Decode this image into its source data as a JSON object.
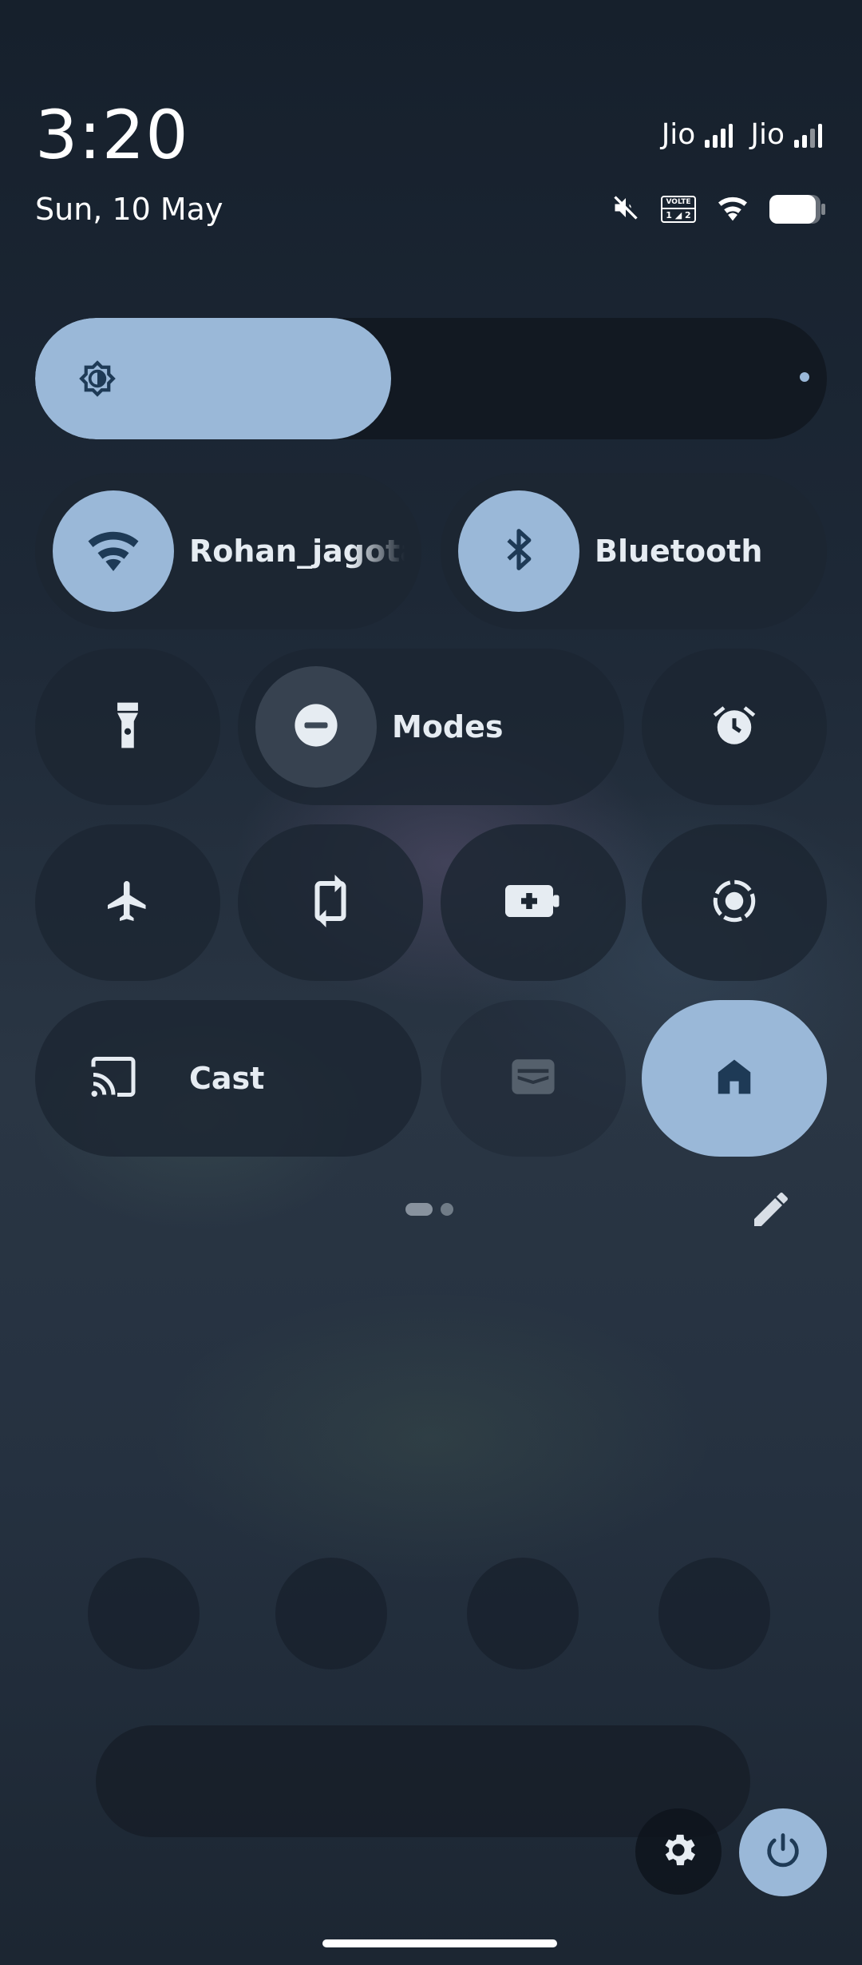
{
  "status_bar": {
    "time": "3:20",
    "date": "Sun, 10 May",
    "carriers": [
      "Jio",
      "Jio"
    ],
    "volte_label": "VOLTE",
    "volte_sim": "1 ◢ 2",
    "icons": [
      "mute-icon",
      "volte-icon",
      "wifi-icon",
      "battery-icon"
    ]
  },
  "brightness": {
    "level": 0.45,
    "icon": "brightness-icon"
  },
  "tiles": {
    "wifi": {
      "label": "Rohan_jagota",
      "state": "on",
      "icon": "wifi-icon"
    },
    "bluetooth": {
      "label": "Bluetooth",
      "state": "on",
      "icon": "bluetooth-icon"
    },
    "flashlight": {
      "icon": "flashlight-icon",
      "state": "off"
    },
    "modes": {
      "label": "Modes",
      "state": "off",
      "icon": "do-not-disturb-icon"
    },
    "alarm": {
      "icon": "alarm-icon",
      "state": "off"
    },
    "airplane": {
      "icon": "airplane-icon",
      "state": "off"
    },
    "rotate": {
      "icon": "auto-rotate-icon",
      "state": "off"
    },
    "battery_saver": {
      "icon": "battery-saver-icon",
      "state": "off"
    },
    "screen_record": {
      "icon": "screen-record-icon",
      "state": "off"
    },
    "cast": {
      "label": "Cast",
      "state": "off",
      "icon": "cast-icon"
    },
    "wallet": {
      "icon": "wallet-icon",
      "state": "unavailable"
    },
    "home": {
      "icon": "home-icon",
      "state": "on"
    }
  },
  "pager": {
    "pages": 2,
    "current": 1
  },
  "footer": {
    "settings_icon": "gear-icon",
    "power_icon": "power-icon"
  },
  "colors": {
    "accent": "#9ab8d8",
    "tile_bg": "#1c2632",
    "text": "#ffffff",
    "icon_dark": "#1e3a56"
  }
}
